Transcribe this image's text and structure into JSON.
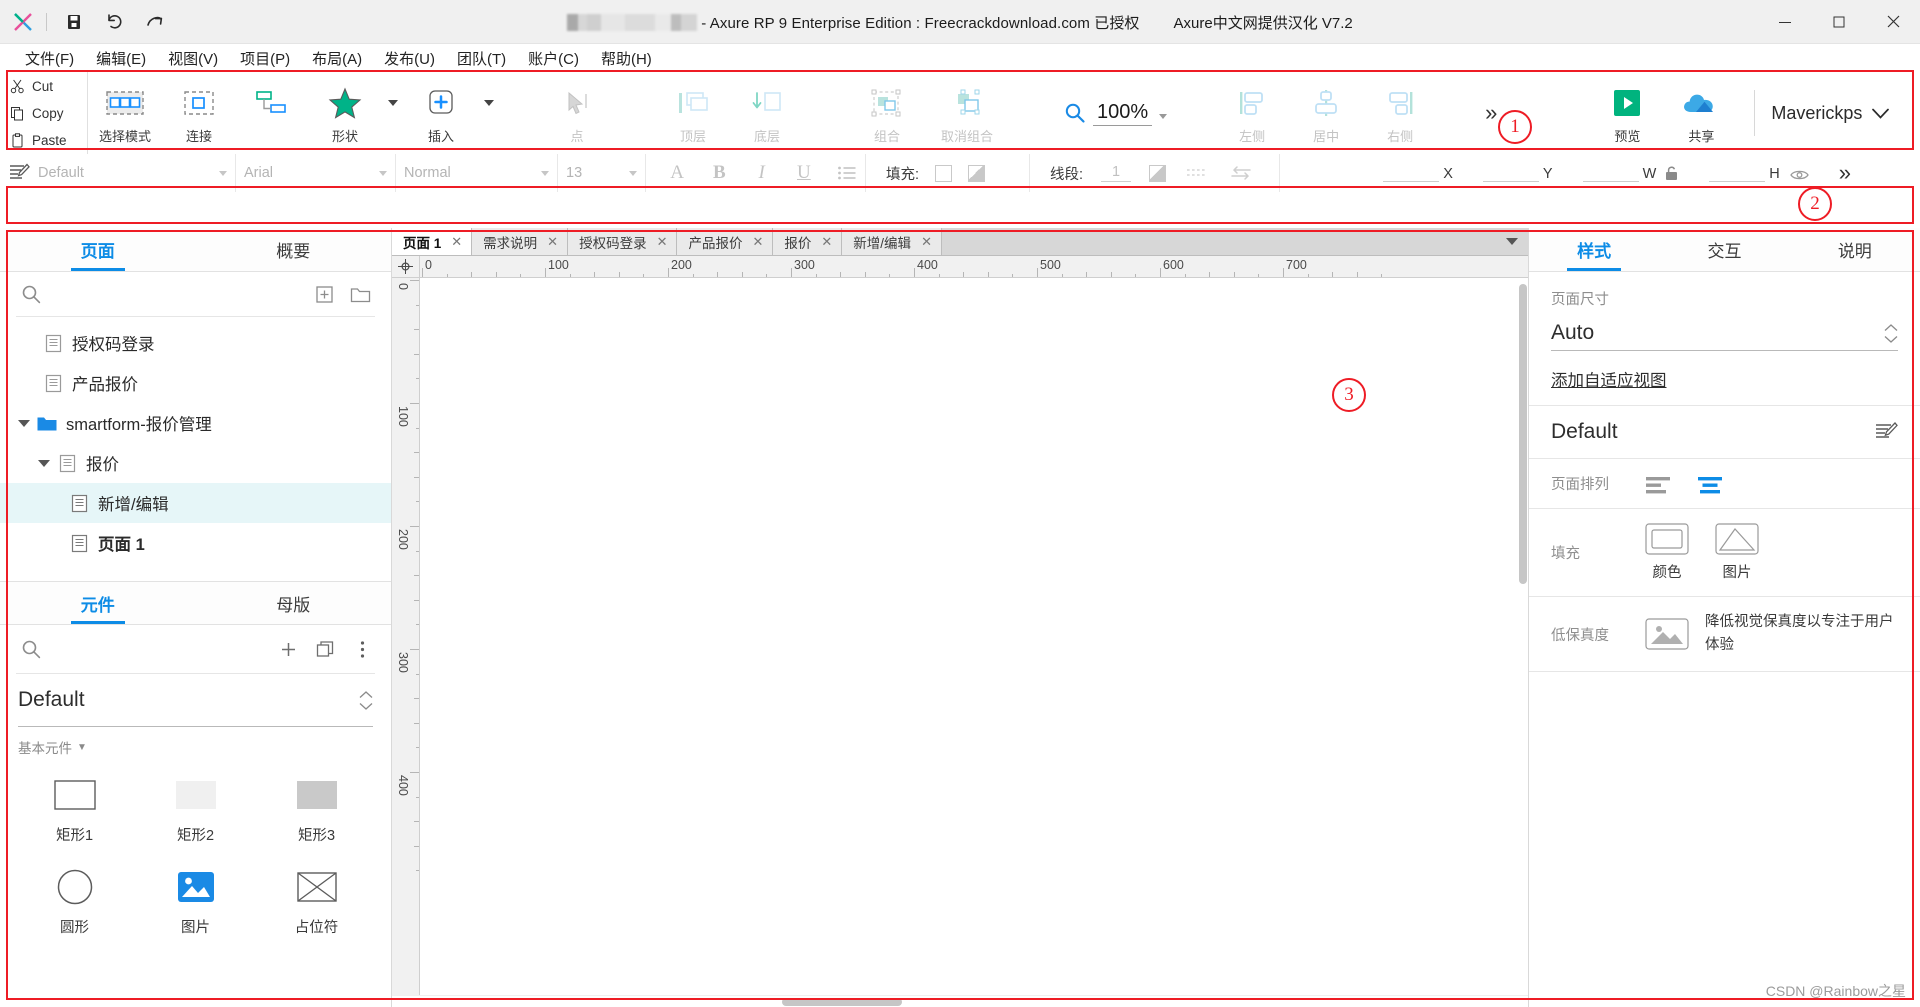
{
  "titlebar": {
    "app_title": "- Axure RP 9 Enterprise Edition : Freecrackdownload.com 已授权",
    "cn_title": "Axure中文网提供汉化 V7.2",
    "icons": [
      "axure-logo-icon",
      "save-icon",
      "undo-icon",
      "redo-icon"
    ],
    "window_buttons": [
      "minimize",
      "maximize",
      "close"
    ]
  },
  "menubar": {
    "items": [
      {
        "label": "文件(F)",
        "name": "menu-file"
      },
      {
        "label": "编辑(E)",
        "name": "menu-edit"
      },
      {
        "label": "视图(V)",
        "name": "menu-view"
      },
      {
        "label": "项目(P)",
        "name": "menu-project"
      },
      {
        "label": "布局(A)",
        "name": "menu-layout"
      },
      {
        "label": "发布(U)",
        "name": "menu-publish"
      },
      {
        "label": "团队(T)",
        "name": "menu-team"
      },
      {
        "label": "账户(C)",
        "name": "menu-account"
      },
      {
        "label": "帮助(H)",
        "name": "menu-help"
      }
    ]
  },
  "toolbar": {
    "clipboard": [
      {
        "label": "Cut",
        "name": "cut-button"
      },
      {
        "label": "Copy",
        "name": "copy-button"
      },
      {
        "label": "Paste",
        "name": "paste-button"
      }
    ],
    "buttons": [
      {
        "label": "选择模式",
        "name": "select-mode-button",
        "disabled": false,
        "dropdown": false
      },
      {
        "label": "连接",
        "name": "connect-button",
        "disabled": false,
        "dropdown": false
      },
      {
        "label": "形状",
        "name": "shape-button",
        "disabled": false,
        "dropdown": true
      },
      {
        "label": "插入",
        "name": "insert-button",
        "disabled": false,
        "dropdown": true
      },
      {
        "label": "点",
        "name": "point-button",
        "disabled": true,
        "dropdown": false
      },
      {
        "label": "顶层",
        "name": "bring-front-button",
        "disabled": true,
        "dropdown": false
      },
      {
        "label": "底层",
        "name": "send-back-button",
        "disabled": true,
        "dropdown": false
      },
      {
        "label": "组合",
        "name": "group-button",
        "disabled": true,
        "dropdown": false
      },
      {
        "label": "取消组合",
        "name": "ungroup-button",
        "disabled": true,
        "dropdown": false
      }
    ],
    "zoom": "100%",
    "align_buttons": [
      {
        "label": "左侧",
        "name": "align-left-button"
      },
      {
        "label": "居中",
        "name": "align-center-button"
      },
      {
        "label": "右侧",
        "name": "align-right-button"
      }
    ],
    "more_label": "»",
    "preview": {
      "label": "预览",
      "name": "preview-button"
    },
    "share": {
      "label": "共享",
      "name": "share-button"
    },
    "user": "Maverickps",
    "annotation_1": "1"
  },
  "formatbar": {
    "style_select": "Default",
    "font_family": "Arial",
    "font_weight": "Normal",
    "font_size": "13",
    "text_buttons": [
      "text-color-A",
      "bold-B",
      "italic-I",
      "underline-U",
      "list-icon"
    ],
    "fill_label": "填充:",
    "line_label": "线段:",
    "line_width": "1",
    "x_label": "X",
    "y_label": "Y",
    "w_label": "W",
    "h_label": "H",
    "more_label": "»",
    "annotation_2": "2"
  },
  "left_panel": {
    "page_tabs": [
      {
        "label": "页面",
        "name": "tab-pages",
        "active": true
      },
      {
        "label": "概要",
        "name": "tab-outline",
        "active": false
      }
    ],
    "search_placeholder": "",
    "tree": [
      {
        "label": "授权码登录",
        "indent": 1,
        "icon": "page-icon",
        "arrow": false,
        "selected": false,
        "bold": false
      },
      {
        "label": "产品报价",
        "indent": 1,
        "icon": "page-icon",
        "arrow": false,
        "selected": false,
        "bold": false
      },
      {
        "label": "smartform-报价管理",
        "indent": 0,
        "icon": "folder-icon",
        "arrow": true,
        "selected": false,
        "bold": false
      },
      {
        "label": "报价",
        "indent": 1,
        "icon": "page-icon",
        "arrow": true,
        "selected": false,
        "bold": false
      },
      {
        "label": "新增/编辑",
        "indent": 2,
        "icon": "page-icon",
        "arrow": false,
        "selected": true,
        "bold": false
      },
      {
        "label": "页面 1",
        "indent": 2,
        "icon": "page-icon",
        "arrow": false,
        "selected": false,
        "bold": true
      }
    ],
    "widget_tabs": [
      {
        "label": "元件",
        "name": "tab-widgets",
        "active": true
      },
      {
        "label": "母版",
        "name": "tab-masters",
        "active": false
      }
    ],
    "library_name": "Default",
    "section_label": "基本元件",
    "widgets": [
      {
        "label": "矩形1",
        "name": "widget-rectangle-1",
        "icon": "rectangle-outline"
      },
      {
        "label": "矩形2",
        "name": "widget-rectangle-2",
        "icon": "rectangle-light-fill"
      },
      {
        "label": "矩形3",
        "name": "widget-rectangle-3",
        "icon": "rectangle-gray-fill"
      },
      {
        "label": "圆形",
        "name": "widget-ellipse",
        "icon": "circle-outline"
      },
      {
        "label": "图片",
        "name": "widget-image",
        "icon": "image-icon"
      },
      {
        "label": "占位符",
        "name": "widget-placeholder",
        "icon": "placeholder-icon"
      }
    ]
  },
  "center": {
    "doc_tabs": [
      {
        "label": "页面 1",
        "name": "doctab-page1",
        "active": true
      },
      {
        "label": "需求说明",
        "name": "doctab-requirements",
        "active": false
      },
      {
        "label": "授权码登录",
        "name": "doctab-license-login",
        "active": false
      },
      {
        "label": "产品报价",
        "name": "doctab-product-quote",
        "active": false
      },
      {
        "label": "报价",
        "name": "doctab-quote",
        "active": false
      },
      {
        "label": "新增/编辑",
        "name": "doctab-add-edit",
        "active": false
      }
    ],
    "tab_close": "✕",
    "ruler_h": [
      "0",
      "100",
      "200",
      "300",
      "400",
      "500",
      "600",
      "700"
    ],
    "ruler_v": [
      "0",
      "100",
      "200",
      "300",
      "400"
    ],
    "annotation_3": "3"
  },
  "right_panel": {
    "tabs": [
      {
        "label": "样式",
        "name": "tab-style",
        "active": true
      },
      {
        "label": "交互",
        "name": "tab-interactions",
        "active": false
      },
      {
        "label": "说明",
        "name": "tab-notes",
        "active": false
      }
    ],
    "page_size_label": "页面尺寸",
    "page_size_value": "Auto",
    "adaptive_link": "添加自适应视图",
    "style_name": "Default",
    "arrange_label": "页面排列",
    "fill_label": "填充",
    "fill_options": [
      {
        "label": "颜色",
        "name": "fill-color-button"
      },
      {
        "label": "图片",
        "name": "fill-image-button"
      }
    ],
    "lowfi_label": "低保真度",
    "lowfi_text": "降低视觉保真度以专注于用户体验"
  },
  "watermark": "CSDN @Rainbow之星",
  "colors": {
    "accent_blue": "#0d8ce6",
    "annotation_red": "#ee1c25",
    "green": "#00b388",
    "selected_row": "#e6f6f8"
  }
}
